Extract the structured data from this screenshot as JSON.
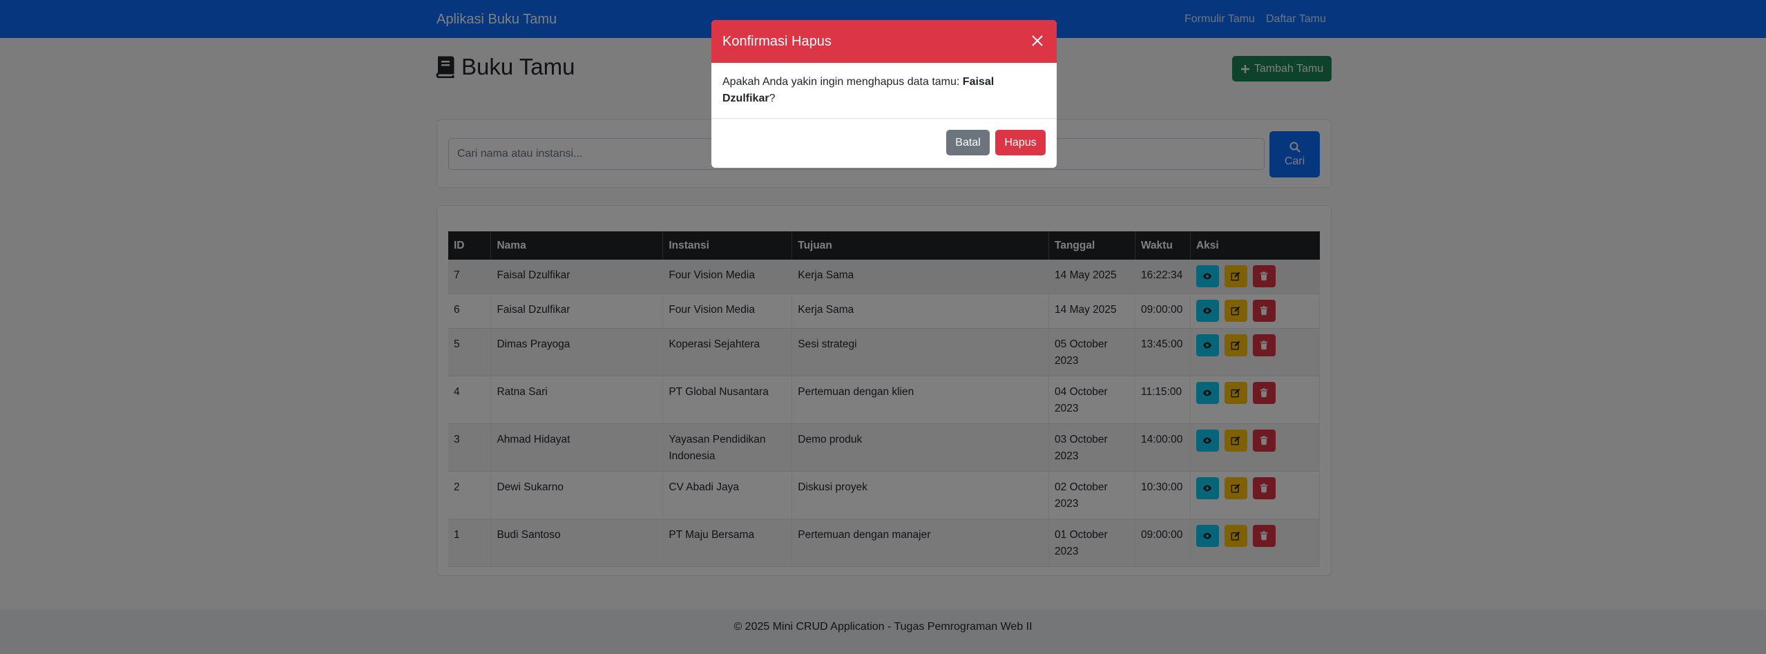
{
  "navbar": {
    "brand": "Aplikasi Buku Tamu",
    "links": [
      "Formulir Tamu",
      "Daftar Tamu"
    ]
  },
  "header": {
    "title": "Buku Tamu",
    "add_button": "Tambah Tamu"
  },
  "search": {
    "placeholder": "Cari nama atau instansi...",
    "button": "Cari"
  },
  "table": {
    "columns": [
      "ID",
      "Nama",
      "Instansi",
      "Tujuan",
      "Tanggal",
      "Waktu",
      "Aksi"
    ],
    "rows": [
      {
        "id": "7",
        "nama": "Faisal Dzulfikar",
        "instansi": "Four Vision Media",
        "tujuan": "Kerja Sama",
        "tanggal": "14 May 2025",
        "waktu": "16:22:34"
      },
      {
        "id": "6",
        "nama": "Faisal Dzulfikar",
        "instansi": "Four Vision Media",
        "tujuan": "Kerja Sama",
        "tanggal": "14 May 2025",
        "waktu": "09:00:00"
      },
      {
        "id": "5",
        "nama": "Dimas Prayoga",
        "instansi": "Koperasi Sejahtera",
        "tujuan": "Sesi strategi",
        "tanggal": "05 October 2023",
        "waktu": "13:45:00"
      },
      {
        "id": "4",
        "nama": "Ratna Sari",
        "instansi": "PT Global Nusantara",
        "tujuan": "Pertemuan dengan klien",
        "tanggal": "04 October 2023",
        "waktu": "11:15:00"
      },
      {
        "id": "3",
        "nama": "Ahmad Hidayat",
        "instansi": "Yayasan Pendidikan Indonesia",
        "tujuan": "Demo produk",
        "tanggal": "03 October 2023",
        "waktu": "14:00:00"
      },
      {
        "id": "2",
        "nama": "Dewi Sukarno",
        "instansi": "CV Abadi Jaya",
        "tujuan": "Diskusi proyek",
        "tanggal": "02 October 2023",
        "waktu": "10:30:00"
      },
      {
        "id": "1",
        "nama": "Budi Santoso",
        "instansi": "PT Maju Bersama",
        "tujuan": "Pertemuan dengan manajer",
        "tanggal": "01 October 2023",
        "waktu": "09:00:00"
      }
    ]
  },
  "footer": {
    "text": "© 2025 Mini CRUD Application - Tugas Pemrograman Web II"
  },
  "modal": {
    "title": "Konfirmasi Hapus",
    "message_prefix": "Apakah Anda yakin ingin menghapus data tamu: ",
    "guest_name": "Faisal Dzulfikar",
    "message_suffix": "?",
    "cancel_button": "Batal",
    "confirm_button": "Hapus"
  },
  "icons": {
    "page_title": "book-icon",
    "add": "plus-icon",
    "search": "search-icon",
    "view": "eye-icon",
    "edit": "edit-icon",
    "delete": "trash-icon",
    "close": "close-icon"
  },
  "colors": {
    "primary": "#0d6efd",
    "success": "#198754",
    "danger": "#dc3545",
    "info": "#0dcaf0",
    "warning": "#ffc107",
    "secondary": "#6c757d",
    "dark": "#212529"
  }
}
